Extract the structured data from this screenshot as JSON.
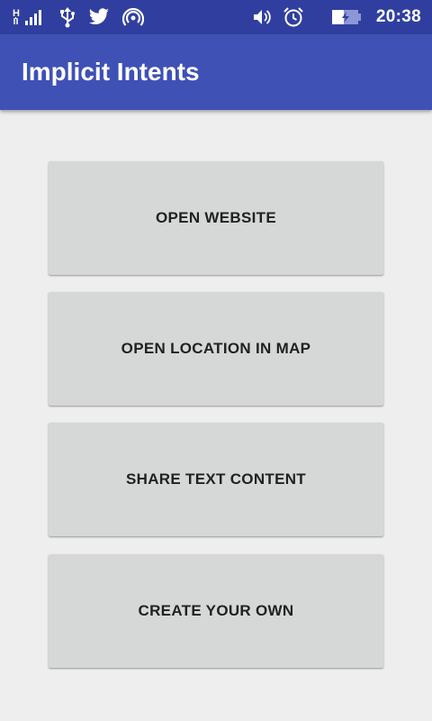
{
  "status_bar": {
    "time": "20:38",
    "network_type": "H",
    "icons": [
      "signal-icon",
      "usb-icon",
      "twitter-icon",
      "hotspot-icon",
      "volume-icon",
      "alarm-icon",
      "battery-charging-icon"
    ]
  },
  "app_bar": {
    "title": "Implicit Intents"
  },
  "buttons": [
    {
      "label": "OPEN WEBSITE"
    },
    {
      "label": "OPEN LOCATION IN MAP"
    },
    {
      "label": "SHARE TEXT CONTENT"
    },
    {
      "label": "CREATE YOUR OWN"
    }
  ],
  "colors": {
    "status_bar": "#303f9f",
    "app_bar": "#3f51b5",
    "background": "#eeeeee",
    "button": "#d6d7d7",
    "button_text": "#212121"
  }
}
